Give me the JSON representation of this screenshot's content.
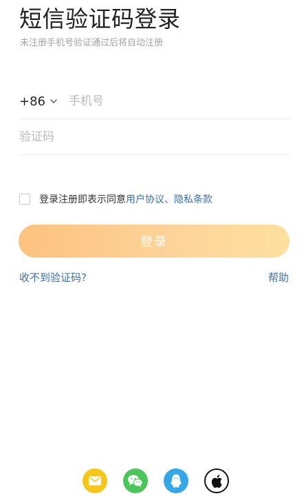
{
  "header": {
    "title": "短信验证码登录",
    "subtitle": "未注册手机号验证通过后将自动注册"
  },
  "form": {
    "country_code": "+86",
    "phone_placeholder": "手机号",
    "code_placeholder": "验证码"
  },
  "agreement": {
    "prefix": "登录注册即表示同意",
    "user_agreement": "用户协议",
    "separator": "、",
    "privacy_policy": "隐私条款"
  },
  "actions": {
    "login_label": "登录",
    "no_code_label": "收不到验证码?",
    "help_label": "帮助"
  },
  "social": [
    {
      "name": "mail-icon",
      "color": "#f8c61b"
    },
    {
      "name": "wechat-icon",
      "color": "#4cc55a"
    },
    {
      "name": "qq-icon",
      "color": "#35a7e8"
    },
    {
      "name": "apple-icon",
      "color": "#111111"
    }
  ],
  "colors": {
    "link": "#3b6fa6",
    "button_gradient_start": "#fcc27f",
    "button_gradient_end": "#fde09f"
  }
}
